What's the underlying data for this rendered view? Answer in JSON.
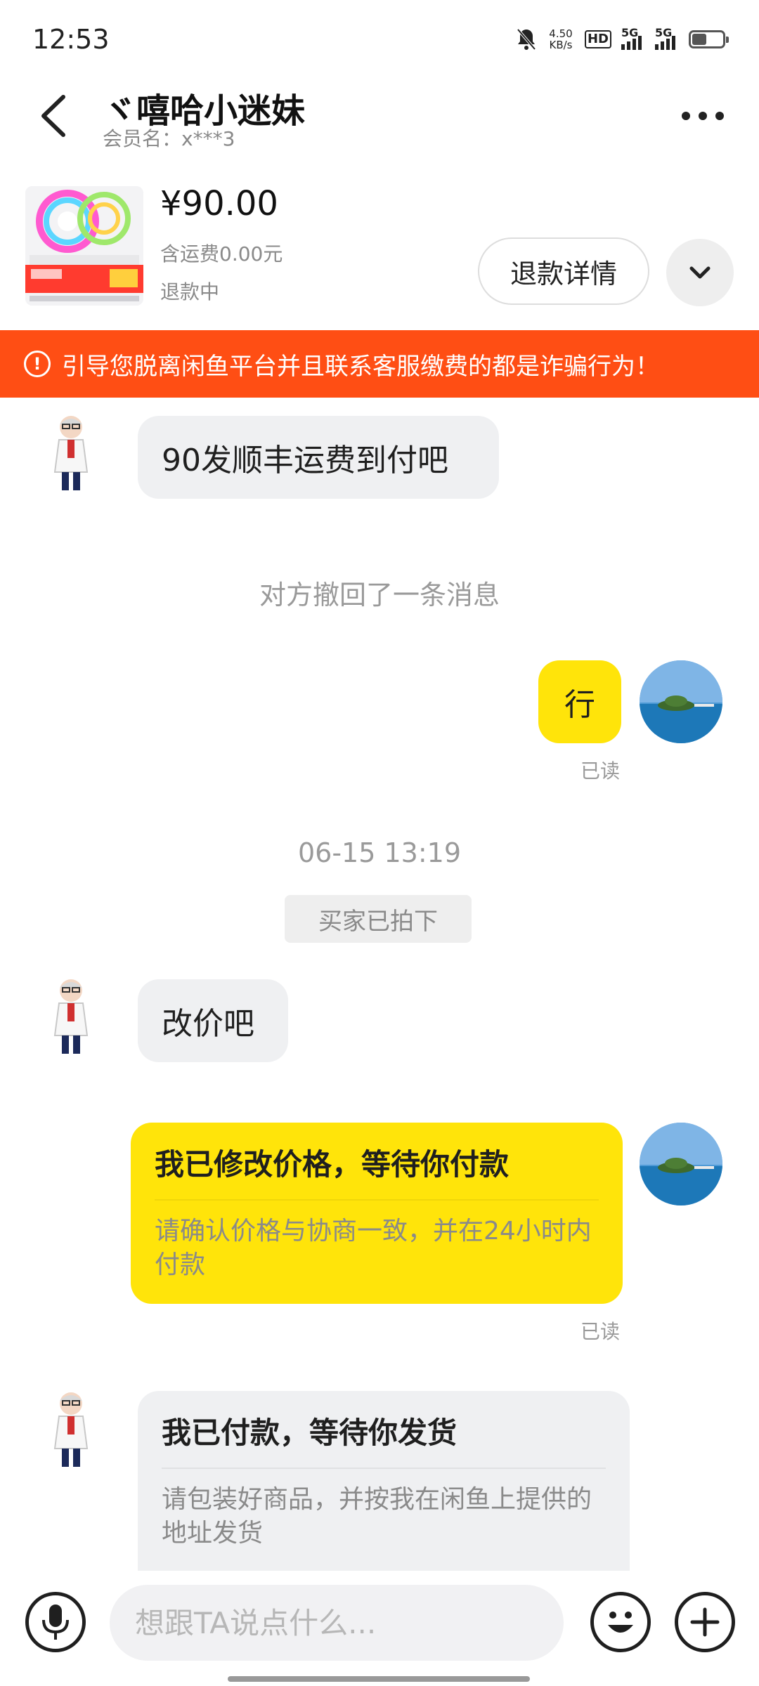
{
  "status_bar": {
    "time": "12:53",
    "net_speed_value": "4.50",
    "net_speed_unit": "KB/s",
    "hd_label": "HD",
    "sim1_label": "5G",
    "sim2_label": "5G",
    "battery_level": 0.4
  },
  "header": {
    "title": "ヾ嘻哈小迷妹",
    "member_label": "会员名：x***3"
  },
  "product": {
    "price": "¥90.00",
    "shipping": "含运费0.00元",
    "status": "退款中",
    "refund_button": "退款详情"
  },
  "warning": {
    "icon": "exclamation-circle-icon",
    "text": "引导您脱离闲鱼平台并且联系客服缴费的都是诈骗行为！"
  },
  "messages": {
    "m1": "90发顺丰运费到付吧",
    "recalled": "对方撤回了一条消息",
    "m2": "行",
    "m2_status": "已读",
    "timestamp": "06-15 13:19",
    "order_event": "买家已拍下",
    "m3": "改价吧",
    "card1_title": "我已修改价格，等待你付款",
    "card1_body": "请确认价格与协商一致，并在24小时内付款",
    "card1_status": "已读",
    "card2_title": "我已付款，等待你发货",
    "card2_body": "请包装好商品，并按我在闲鱼上提供的地址发货"
  },
  "input_bar": {
    "placeholder": "想跟TA说点什么..."
  },
  "colors": {
    "accent_yellow": "#ffe40a",
    "warning_orange": "#ff4e14",
    "incoming_bubble": "#eff0f2"
  }
}
